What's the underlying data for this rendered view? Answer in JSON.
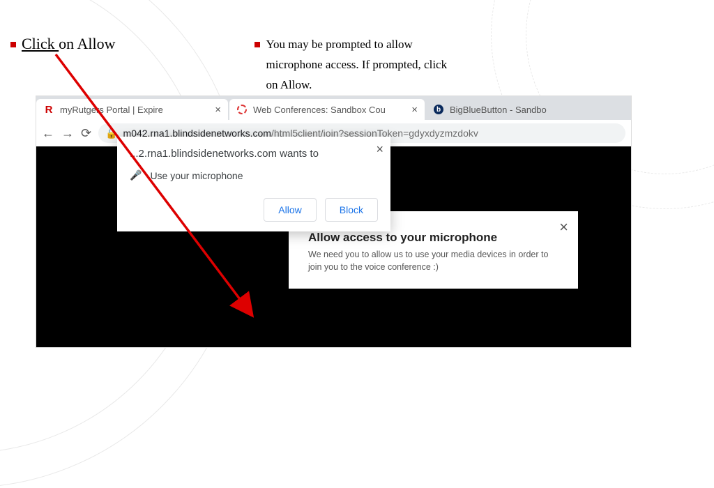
{
  "bullet1": {
    "click": "Click ",
    "rest": "on Allow"
  },
  "bullet2": "You may be prompted to allow microphone access. If prompted, click on Allow.",
  "tabs": [
    {
      "label": "myRutgers Portal | Expire"
    },
    {
      "label": "Web Conferences: Sandbox Cou"
    },
    {
      "label": "BigBlueButton - Sandbo"
    }
  ],
  "url": {
    "host": "m042.rna1.blindsidenetworks.com",
    "path": "/html5client/join?sessionToken=gdyxdyzmzdokv"
  },
  "perm": {
    "origin": "...2.rna1.blindsidenetworks.com wants to",
    "ask": "Use your microphone",
    "allow": "Allow",
    "block": "Block"
  },
  "modal": {
    "title": "Allow access to your microphone",
    "body": "We need you to allow us to use your media devices in order to join you to the voice conference :)"
  }
}
